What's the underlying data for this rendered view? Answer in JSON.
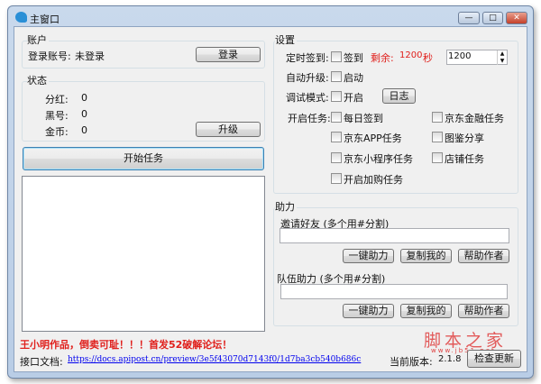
{
  "window": {
    "title": "主窗口",
    "minimize": "—",
    "maximize": "□",
    "close": "✕"
  },
  "account": {
    "group": "账户",
    "login_label": "登录账号:",
    "login_value": "未登录",
    "login_button": "登录"
  },
  "status": {
    "group": "状态",
    "rows": [
      {
        "label": "分红:",
        "value": "0"
      },
      {
        "label": "黑号:",
        "value": "0"
      },
      {
        "label": "金币:",
        "value": "0"
      }
    ],
    "upgrade_button": "升级"
  },
  "start_button": "开始任务",
  "log_text": "",
  "settings": {
    "group": "设置",
    "timed_sign_label": "定时签到:",
    "timed_sign_check": "签到",
    "remaining_label": "剩余:",
    "remaining_value": "1200",
    "remaining_unit": "秒",
    "interval_value": "1200",
    "auto_upgrade_label": "自动升级:",
    "auto_upgrade_check": "启动",
    "debug_label": "调试模式:",
    "debug_check": "开启",
    "log_button": "日志",
    "tasks_label": "开启任务:",
    "tasks": [
      "每日签到",
      "京东金融任务",
      "京东APP任务",
      "图鉴分享",
      "京东小程序任务",
      "店铺任务",
      "开启加购任务"
    ]
  },
  "assist": {
    "group": "助力",
    "invite_label": "邀请好友 (多个用#分割)",
    "invite_value": "",
    "team_label": "队伍助力 (多个用#分割)",
    "team_value": "",
    "one_click": "一键助力",
    "copy_mine": "复制我的",
    "help_author": "帮助作者"
  },
  "footer": {
    "notice": "王小明作品，倒卖可耻！！！首发52破解论坛！",
    "api_doc_label": "接口文档:",
    "api_doc_link": "https://docs.apipost.cn/preview/3e5f43070d7143f0/1d7ba3cb540b686c",
    "version_label": "当前版本:",
    "version": "2.1.8",
    "check_update": "检查更新"
  },
  "watermark": {
    "text": "脚本之家",
    "url": "www.jb51.net"
  },
  "colors": {
    "red": "#e0201c",
    "link": "#0000ee"
  }
}
